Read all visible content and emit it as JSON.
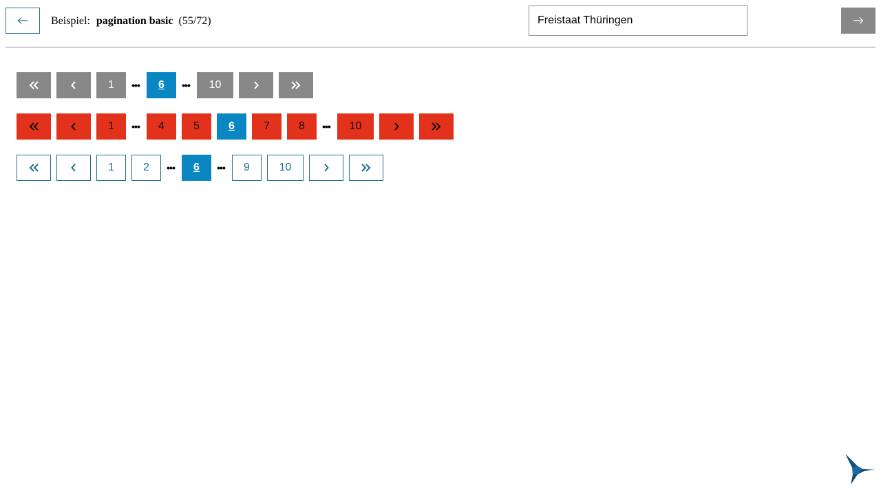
{
  "header": {
    "back_icon": "arrow-left-icon",
    "title_prefix": "Beispiel:",
    "title_name": "pagination basic",
    "title_counter": "(55/72)",
    "select_value": "Freistaat Thüringen",
    "next_icon": "arrow-right-icon"
  },
  "pagination_gray": {
    "style": "gray",
    "first_icon": "double-chevron-left-icon",
    "prev_icon": "chevron-left-icon",
    "pages": [
      "1",
      "…",
      "6",
      "…",
      "10"
    ],
    "current": "6",
    "next_icon": "chevron-right-icon",
    "last_icon": "double-chevron-right-icon"
  },
  "pagination_red": {
    "style": "red",
    "first_icon": "double-chevron-left-icon",
    "prev_icon": "chevron-left-icon",
    "pages": [
      "1",
      "…",
      "4",
      "5",
      "6",
      "7",
      "8",
      "…",
      "10"
    ],
    "current": "6",
    "next_icon": "chevron-right-icon",
    "last_icon": "double-chevron-right-icon"
  },
  "pagination_outline": {
    "style": "outline",
    "first_icon": "double-chevron-left-icon",
    "prev_icon": "chevron-left-icon",
    "pages": [
      "1",
      "2",
      "…",
      "6",
      "…",
      "9",
      "10"
    ],
    "current": "6",
    "next_icon": "chevron-right-icon",
    "last_icon": "double-chevron-right-icon"
  },
  "colors": {
    "gray": "#888888",
    "red": "#e2321b",
    "outline": "#1e6e91",
    "current": "#0a87c2"
  },
  "logo_icon": "hummingbird-logo-icon"
}
